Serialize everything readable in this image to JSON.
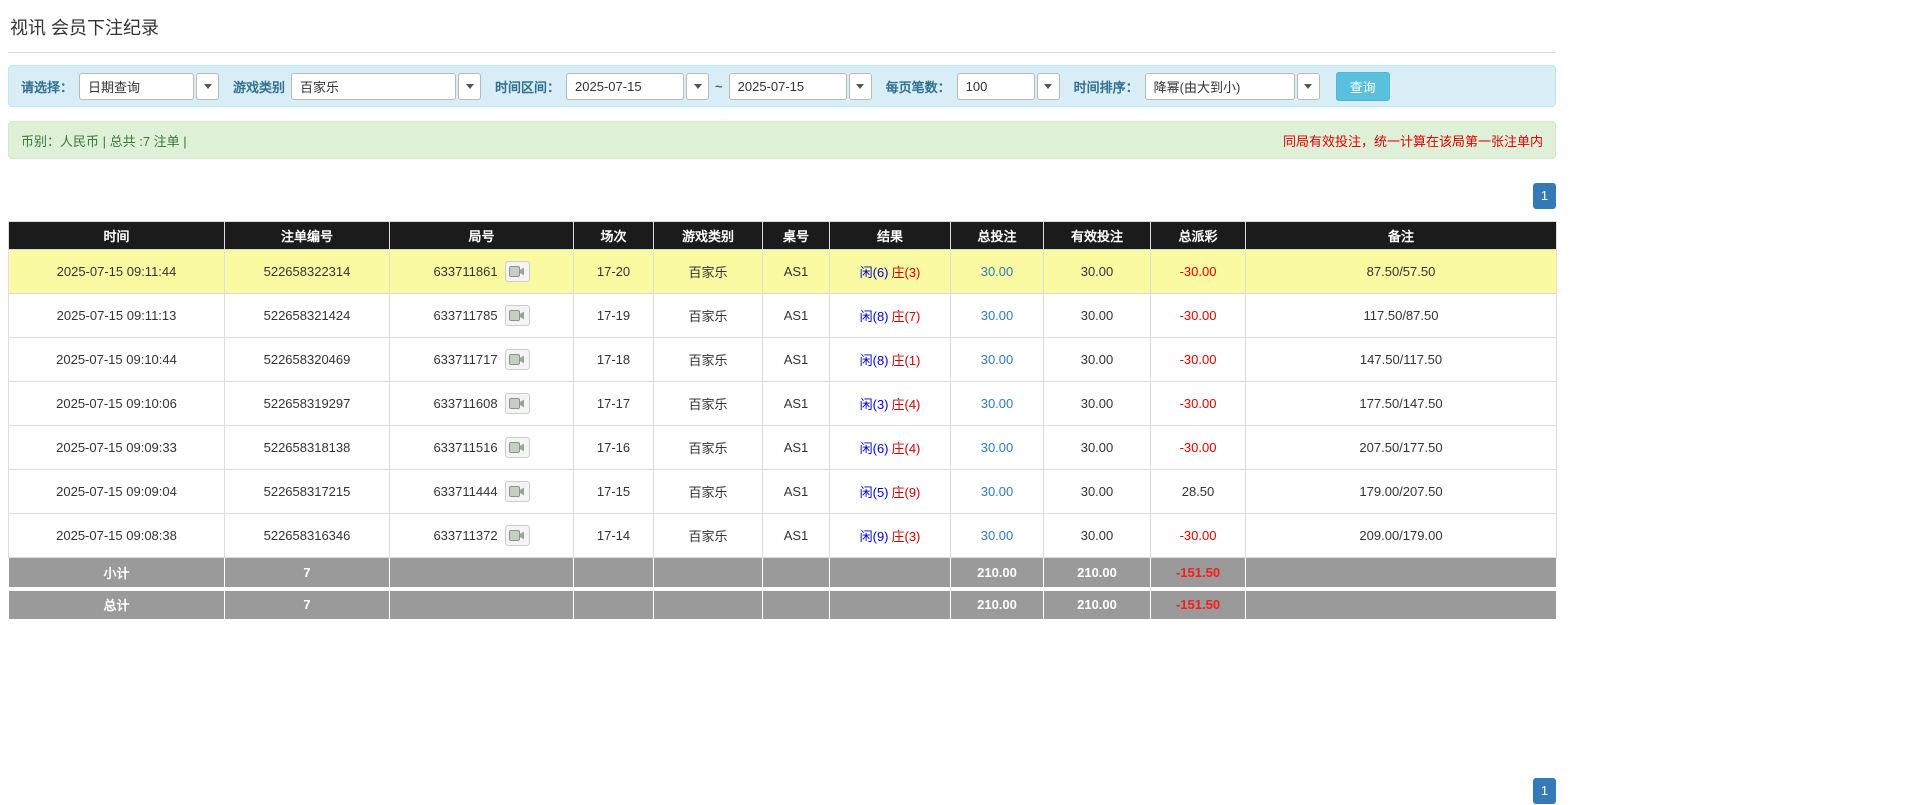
{
  "page": {
    "title": "视讯 会员下注纪录"
  },
  "filters": {
    "select_label": "请选择：",
    "select_value": "日期查询",
    "game_type_label": "游戏类别",
    "game_type_value": "百家乐",
    "time_range_label": "时间区间：",
    "date_from": "2025-07-15",
    "date_separator": "~",
    "date_to": "2025-07-15",
    "page_size_label": "每页笔数：",
    "page_size_value": "100",
    "sort_label": "时间排序：",
    "sort_value": "降幂(由大到小)",
    "search_button_label": "查询"
  },
  "summary": {
    "left": "币别：人民币 | 总共 :7 注单 |",
    "right": "同局有效投注，统一计算在该局第一张注单内"
  },
  "pagination": {
    "page": "1"
  },
  "table": {
    "headers": [
      "时间",
      "注单编号",
      "局号",
      "场次",
      "游戏类别",
      "桌号",
      "结果",
      "总投注",
      "有效投注",
      "总派彩",
      "备注"
    ],
    "rows": [
      {
        "time": "2025-07-15 09:11:44",
        "bet_id": "522658322314",
        "round_id": "633711861",
        "session": "17-20",
        "game": "百家乐",
        "table_id": "AS1",
        "result_player": "闲(6)",
        "result_banker": "庄(3)",
        "total_bet": "30.00",
        "valid_bet": "30.00",
        "payout": "-30.00",
        "remark": "87.50/57.50",
        "highlight": true
      },
      {
        "time": "2025-07-15 09:11:13",
        "bet_id": "522658321424",
        "round_id": "633711785",
        "session": "17-19",
        "game": "百家乐",
        "table_id": "AS1",
        "result_player": "闲(8)",
        "result_banker": "庄(7)",
        "total_bet": "30.00",
        "valid_bet": "30.00",
        "payout": "-30.00",
        "remark": "117.50/87.50",
        "highlight": false
      },
      {
        "time": "2025-07-15 09:10:44",
        "bet_id": "522658320469",
        "round_id": "633711717",
        "session": "17-18",
        "game": "百家乐",
        "table_id": "AS1",
        "result_player": "闲(8)",
        "result_banker": "庄(1)",
        "total_bet": "30.00",
        "valid_bet": "30.00",
        "payout": "-30.00",
        "remark": "147.50/117.50",
        "highlight": false
      },
      {
        "time": "2025-07-15 09:10:06",
        "bet_id": "522658319297",
        "round_id": "633711608",
        "session": "17-17",
        "game": "百家乐",
        "table_id": "AS1",
        "result_player": "闲(3)",
        "result_banker": "庄(4)",
        "total_bet": "30.00",
        "valid_bet": "30.00",
        "payout": "-30.00",
        "remark": "177.50/147.50",
        "highlight": false
      },
      {
        "time": "2025-07-15 09:09:33",
        "bet_id": "522658318138",
        "round_id": "633711516",
        "session": "17-16",
        "game": "百家乐",
        "table_id": "AS1",
        "result_player": "闲(6)",
        "result_banker": "庄(4)",
        "total_bet": "30.00",
        "valid_bet": "30.00",
        "payout": "-30.00",
        "remark": "207.50/177.50",
        "highlight": false
      },
      {
        "time": "2025-07-15 09:09:04",
        "bet_id": "522658317215",
        "round_id": "633711444",
        "session": "17-15",
        "game": "百家乐",
        "table_id": "AS1",
        "result_player": "闲(5)",
        "result_banker": "庄(9)",
        "total_bet": "30.00",
        "valid_bet": "30.00",
        "payout": "28.50",
        "remark": "179.00/207.50",
        "highlight": false
      },
      {
        "time": "2025-07-15 09:08:38",
        "bet_id": "522658316346",
        "round_id": "633711372",
        "session": "17-14",
        "game": "百家乐",
        "table_id": "AS1",
        "result_player": "闲(9)",
        "result_banker": "庄(3)",
        "total_bet": "30.00",
        "valid_bet": "30.00",
        "payout": "-30.00",
        "remark": "209.00/179.00",
        "highlight": false
      }
    ],
    "subtotal": {
      "label": "小计",
      "count": "7",
      "total_bet": "210.00",
      "valid_bet": "210.00",
      "payout": "-151.50"
    },
    "total": {
      "label": "总计",
      "count": "7",
      "total_bet": "210.00",
      "valid_bet": "210.00",
      "payout": "-151.50"
    }
  },
  "icons": {
    "dropdown_caret": "caret-down-icon",
    "round_replay": "video-replay-icon"
  },
  "colors": {
    "filter-bg": "#d9edf7",
    "filter-border": "#bce8f1",
    "filter-label": "#31708f",
    "button-blue": "#5bc0de",
    "button-blue-border": "#46b8da",
    "summary-bg": "#dff0d8",
    "summary-border": "#d6e9c6",
    "summary-text": "#3c763d",
    "note-red": "#e00000",
    "pagination-blue": "#337ab7",
    "header-bg": "#1b1b1b",
    "highlight-yellow": "#fafaa3",
    "player-blue": "#0000cc",
    "banker-red": "#cc0000",
    "link-blue": "#337ab7",
    "negative-red": "#e00000",
    "footer-bg": "#9a9a9a",
    "footer-negative-red": "#ff1a1a"
  }
}
